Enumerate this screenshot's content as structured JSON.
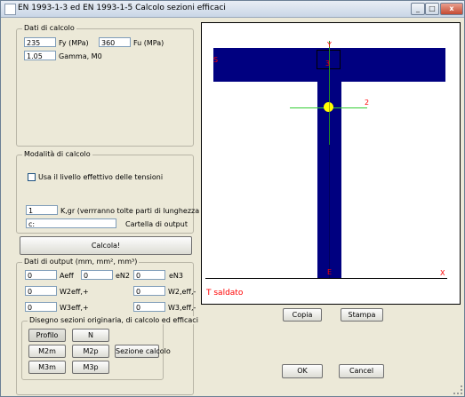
{
  "window": {
    "title": "EN 1993-1-3  ed EN 1993-1-5 Calcolo sezioni efficaci",
    "minimize": "_",
    "maximize": "□",
    "close": "x"
  },
  "dati_calcolo": {
    "legend": "Dati di calcolo",
    "fy_value": "235",
    "fy_label": "Fy (MPa)",
    "fu_value": "360",
    "fu_label": "Fu (MPa)",
    "gamma_value": "1.05",
    "gamma_label": "Gamma, M0"
  },
  "modalita": {
    "legend": "Modalità di calcolo",
    "checkbox_label": "Usa il livello effettivo delle tensioni",
    "kgr_value": "1",
    "kgr_label": "K,gr (verrranno tolte parti di lunghezza K,gr * gr)",
    "folder_value": "c:",
    "folder_label": "Cartella di output"
  },
  "calcola_label": "Calcola!",
  "output": {
    "legend": "Dati di output (mm, mm², mm³)",
    "rows": [
      {
        "v1": "0",
        "l1": "Aeff",
        "v2": "0",
        "l2": "eN2",
        "v3": "0",
        "l3": "eN3"
      },
      {
        "v1": "0",
        "l1": "W2eff,+",
        "v2": "",
        "l2": "",
        "v3": "0",
        "l3": "W2,eff,-"
      },
      {
        "v1": "0",
        "l1": "W3eff,+",
        "v2": "",
        "l2": "",
        "v3": "0",
        "l3": "W3,eff,-"
      }
    ]
  },
  "disegno": {
    "legend": "Disegno sezioni originaria, di calcolo ed efficaci",
    "profilo": "Profilo",
    "n": "N",
    "m2m": "M2m",
    "m2p": "M2p",
    "sezione_calcolo": "Sezione calcolo",
    "m3m": "M3m",
    "m3p": "M3p"
  },
  "drawing": {
    "label_y": "Y",
    "label_s": "S",
    "label_3": "3",
    "label_2": "2",
    "label_e": "E",
    "label_x": "X",
    "caption": "T saldato"
  },
  "buttons": {
    "copia": "Copia",
    "stampa": "Stampa",
    "ok": "OK",
    "cancel": "Cancel"
  }
}
